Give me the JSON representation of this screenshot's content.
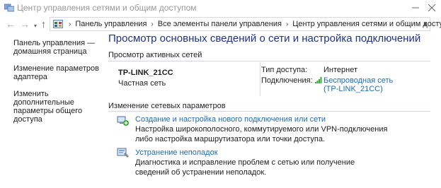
{
  "window": {
    "title": "Центр управления сетями и общим доступом"
  },
  "nav": {
    "back": "←",
    "forward": "→",
    "up": "↑",
    "breadcrumbs": [
      "Панель управления",
      "Все элементы панели управления",
      "Центр управления сетями и общим доступом"
    ],
    "separator": "›"
  },
  "sidebar": {
    "items": [
      {
        "label": "Панель управления — домашняя страница"
      },
      {
        "label": "Изменение параметров адаптера"
      },
      {
        "label": "Изменить дополнительные параметры общего доступа"
      }
    ]
  },
  "main": {
    "title": "Просмотр основных сведений о сети и настройка подключений",
    "active_networks": {
      "heading": "Просмотр активных сетей",
      "network_name": "TP-LINK_21CC",
      "network_type": "Частная сеть",
      "access_type_label": "Тип доступа:",
      "access_type_value": "Интернет",
      "connections_label": "Подключения:",
      "connection_line1": "Беспроводная сеть",
      "connection_line2": "(TP-LINK_21CC)"
    },
    "change_settings": {
      "heading": "Изменение сетевых параметров",
      "tasks": [
        {
          "title": "Создание и настройка нового подключения или сети",
          "description": "Настройка широкополосного, коммутируемого или VPN-подключения либо настройка маршрутизатора или точки доступа."
        },
        {
          "title": "Устранение неполадок",
          "description": "Диагностика и исправление проблем с сетью или получение сведений об устранении неполадок."
        }
      ]
    }
  },
  "colors": {
    "title_blue": "#1e3287",
    "link_blue": "#1b6bb5",
    "signal_green": "#3aa53a"
  }
}
